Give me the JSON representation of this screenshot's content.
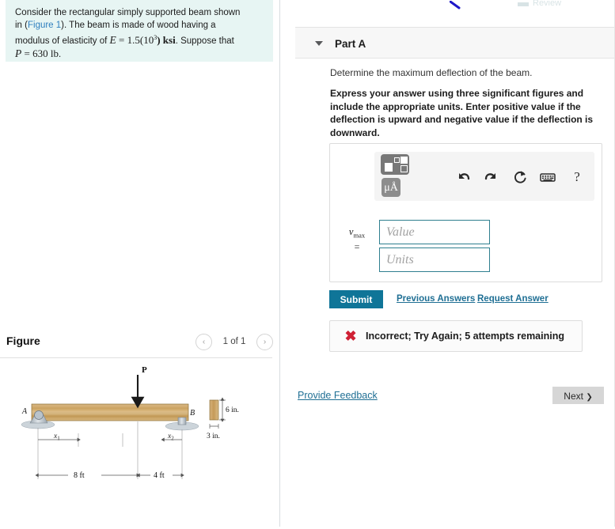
{
  "question": {
    "line1": "Consider the rectangular simply supported beam shown",
    "line2_pre": "in (",
    "line2_link": "Figure 1",
    "line2_post": "). The beam is made of wood having a",
    "line3_pre": "modulus of elasticity of ",
    "line3_E": "E",
    "line3_eq": " = 1.5(10",
    "line3_exp": "3",
    "line3_unit": ") ksi",
    "line3_post": ". Suppose that",
    "line4_P": "P",
    "line4_val": " = 630  lb",
    "line4_end": "."
  },
  "figure": {
    "title": "Figure",
    "pager_prev": "‹",
    "pager_count": "1 of 1",
    "pager_next": "›",
    "diagram": {
      "load_label": "P",
      "support_a_label": "A",
      "support_b_label": "B",
      "dim_x1": "x",
      "dim_x1_sub": "1",
      "dim_x2": "x",
      "dim_x2_sub": "2",
      "span_left": "8 ft",
      "span_right": "4 ft",
      "section_height": "6 in.",
      "section_width": "3 in.",
      "beam_color": "#c4a263",
      "support_color": "#b8c3cc"
    }
  },
  "review": {
    "label": "Review"
  },
  "part": {
    "caret": "▼",
    "title": "Part A",
    "prompt": "Determine the maximum deflection of the beam.",
    "instructions": "Express your answer using three significant figures and include the appropriate units. Enter positive value if the deflection is upward and negative value if the deflection is downward."
  },
  "mathbar": {
    "template_icon": "template-grid-icon",
    "greek_label": "μÅ",
    "undo_icon": "undo-icon",
    "redo_icon": "redo-icon",
    "reset_icon": "reset-icon",
    "keyboard_icon": "keyboard-icon",
    "help_label": "?"
  },
  "answer": {
    "variable": "v",
    "variable_sub": "max",
    "equals": "=",
    "value_placeholder": "Value",
    "value_current": "",
    "units_placeholder": "Units",
    "units_current": ""
  },
  "actions": {
    "submit": "Submit",
    "previous_answers": "Previous Answers",
    "request_answer": "Request Answer"
  },
  "feedback": {
    "icon": "✖",
    "message": "Incorrect; Try Again; 5 attempts remaining",
    "color": "#cf2034"
  },
  "footer": {
    "provide_feedback": "Provide Feedback",
    "next": "Next",
    "next_chevron": "❯"
  },
  "colors": {
    "accent": "#0f7598",
    "link": "#1f6f94",
    "question_bg": "#e7f5f3",
    "panel_bg": "#f7f7f7"
  }
}
